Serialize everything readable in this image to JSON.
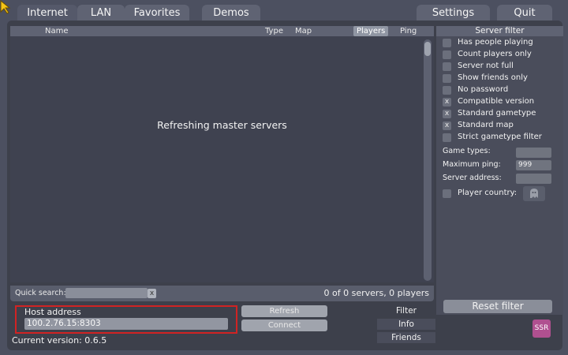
{
  "colors": {
    "background": "#4c5060",
    "panel": "#3d404b",
    "header": "#5f6373",
    "highlight": "#d02323",
    "cursor": "#f5c518"
  },
  "tabs": [
    {
      "label": "Internet",
      "active": true
    },
    {
      "label": "LAN"
    },
    {
      "label": "Favorites"
    },
    {
      "label": "Demos"
    },
    {
      "label": "Settings"
    },
    {
      "label": "Quit"
    }
  ],
  "server_list": {
    "columns": [
      "Name",
      "Type",
      "Map",
      "Players",
      "Ping"
    ],
    "message": "Refreshing master servers",
    "quick_search_label": "Quick search:",
    "quick_search_value": "",
    "clear_label": "x",
    "count_text": "0 of 0 servers, 0 players"
  },
  "filter": {
    "title": "Server filter",
    "options": [
      {
        "label": "Has people playing",
        "checked": false
      },
      {
        "label": "Count players only",
        "checked": false
      },
      {
        "label": "Server not full",
        "checked": false
      },
      {
        "label": "Show friends only",
        "checked": false
      },
      {
        "label": "No password",
        "checked": false
      },
      {
        "label": "Compatible version",
        "checked": true
      },
      {
        "label": "Standard gametype",
        "checked": true
      },
      {
        "label": "Standard map",
        "checked": true
      },
      {
        "label": "Strict gametype filter",
        "checked": false
      }
    ],
    "check_mark": "x",
    "game_types_label": "Game types:",
    "game_types_value": "",
    "max_ping_label": "Maximum ping:",
    "max_ping_value": "999",
    "server_address_label": "Server address:",
    "server_address_value": "",
    "player_country_label": "Player country:",
    "reset_label": "Reset filter"
  },
  "host": {
    "label": "Host address",
    "value": "100.2.76.15:8303"
  },
  "buttons": {
    "refresh": "Refresh",
    "connect": "Connect"
  },
  "side_tabs": [
    "Filter",
    "Info",
    "Friends"
  ],
  "version_text": "Current version: 0.6.5",
  "badge_text": "SSR"
}
